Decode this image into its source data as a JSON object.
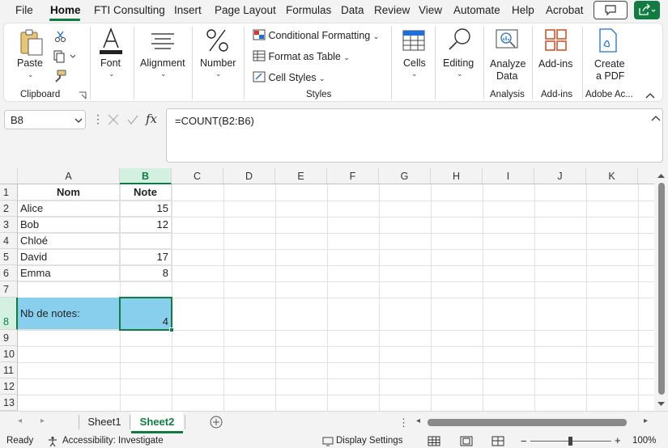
{
  "menu": {
    "tabs": [
      "File",
      "Home",
      "FTI Consulting",
      "Insert",
      "Page Layout",
      "Formulas",
      "Data",
      "Review",
      "View",
      "Automate",
      "Help",
      "Acrobat"
    ],
    "active": "Home"
  },
  "ribbon": {
    "clipboard": {
      "paste": "Paste",
      "label": "Clipboard"
    },
    "font": "Font",
    "alignment": "Alignment",
    "number": "Number",
    "styles": {
      "conditional": "Conditional Formatting",
      "format_table": "Format as Table",
      "cell_styles": "Cell Styles",
      "label": "Styles"
    },
    "cells": "Cells",
    "editing": "Editing",
    "analyze_data": [
      "Analyze",
      "Data"
    ],
    "analysis_label": "Analysis",
    "addins": "Add-ins",
    "addins_label": "Add-ins",
    "create_pdf": [
      "Create",
      "a PDF"
    ],
    "adobe_label": "Adobe Ac..."
  },
  "formula_bar": {
    "name_box": "B8",
    "fx": "fx",
    "formula": "=COUNT(B2:B6)"
  },
  "grid": {
    "columns": [
      "A",
      "B",
      "C",
      "D",
      "E",
      "F",
      "G",
      "H",
      "I",
      "J",
      "K"
    ],
    "rows": [
      "1",
      "2",
      "3",
      "4",
      "5",
      "6",
      "7",
      "8",
      "9",
      "10",
      "11",
      "12",
      "13"
    ],
    "selected_column": "B",
    "selected_row": "8",
    "cells": {
      "A1": "Nom",
      "B1": "Note",
      "A2": "Alice",
      "B2": "15",
      "A3": "Bob",
      "B3": "12",
      "A4": "Chloé",
      "B4": "",
      "A5": "David",
      "B5": "17",
      "A6": "Emma",
      "B6": "8",
      "A8": "Nb de notes:",
      "B8": "4"
    },
    "fill_color": "#87cfec",
    "accent": "#107c41"
  },
  "sheets": {
    "tabs": [
      "Sheet1",
      "Sheet2"
    ],
    "active": "Sheet2"
  },
  "status": {
    "ready": "Ready",
    "accessibility": "Accessibility: Investigate",
    "display": "Display Settings",
    "zoom": "100%"
  }
}
